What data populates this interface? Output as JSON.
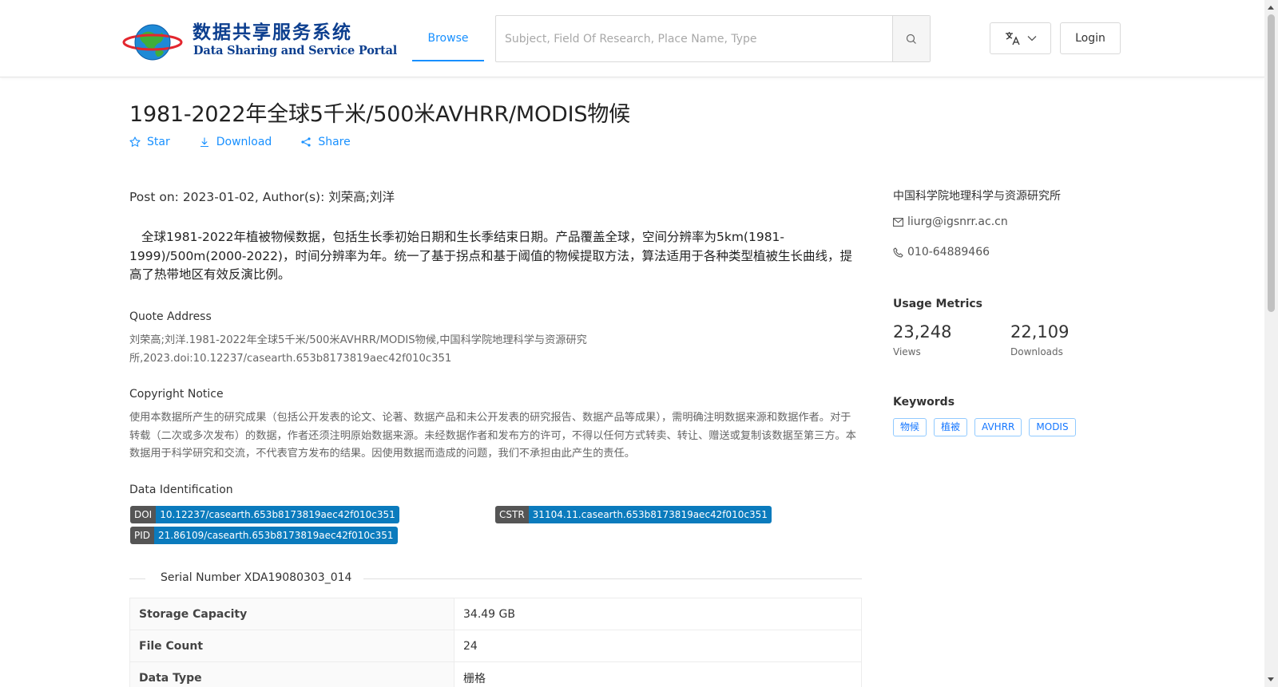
{
  "header": {
    "logo_cn": "数据共享服务系统",
    "logo_en": "Data Sharing and Service Portal",
    "nav_browse": "Browse",
    "search_placeholder": "Subject, Field Of Research, Place Name, Type",
    "login_label": "Login"
  },
  "dataset": {
    "title": "1981-2022年全球5千米/500米AVHRR/MODIS物候",
    "actions": {
      "star": "Star",
      "download": "Download",
      "share": "Share"
    },
    "post_info": "Post on: 2023-01-02, Author(s): 刘荣高;刘洋",
    "description": "全球1981-2022年植被物候数据，包括生长季初始日期和生长季结束日期。产品覆盖全球，空间分辨率为5km(1981-1999)/500m(2000-2022)，时间分辨率为年。统一了基于拐点和基于阈值的物候提取方法，算法适用于各种类型植被生长曲线，提高了热带地区有效反演比例。",
    "quote_heading": "Quote Address",
    "quote_text": "刘荣高;刘洋.1981-2022年全球5千米/500米AVHRR/MODIS物候,中国科学院地理科学与资源研究所,2023.doi:10.12237/casearth.653b8173819aec42f010c351",
    "copyright_heading": "Copyright Notice",
    "copyright_text": "使用本数据所产生的研究成果（包括公开发表的论文、论著、数据产品和未公开发表的研究报告、数据产品等成果），需明确注明数据来源和数据作者。对于转载（二次或多次发布）的数据，作者还须注明原始数据来源。未经数据作者和发布方的许可，不得以任何方式转卖、转让、赠送或复制该数据至第三方。本数据用于科学研究和交流，不代表官方发布的结果。因使用数据而造成的问题，我们不承担由此产生的责任。",
    "identification_heading": "Data Identification",
    "identifiers": {
      "doi": {
        "key": "DOI",
        "value": "10.12237/casearth.653b8173819aec42f010c351"
      },
      "cstr": {
        "key": "CSTR",
        "value": "31104.11.casearth.653b8173819aec42f010c351"
      },
      "pid": {
        "key": "PID",
        "value": "21.86109/casearth.653b8173819aec42f010c351"
      }
    },
    "serial_number": "Serial Number XDA19080303_014",
    "table": {
      "storage": {
        "key": "Storage Capacity",
        "value": "34.49 GB"
      },
      "files": {
        "key": "File Count",
        "value": "24"
      },
      "type": {
        "key": "Data Type",
        "value": "栅格"
      }
    }
  },
  "sidebar": {
    "institution": "中国科学院地理科学与资源研究所",
    "email": "liurg@igsnrr.ac.cn",
    "phone": "010-64889466",
    "metrics_heading": "Usage Metrics",
    "views": {
      "value": "23,248",
      "label": "Views"
    },
    "downloads": {
      "value": "22,109",
      "label": "Downloads"
    },
    "keywords_heading": "Keywords",
    "keywords": [
      "物候",
      "植被",
      "AVHRR",
      "MODIS"
    ]
  },
  "colors": {
    "accent": "#1890ff",
    "badge_value": "#0b7bbd",
    "badge_key": "#555555",
    "logo_blue": "#0d3f8f"
  }
}
